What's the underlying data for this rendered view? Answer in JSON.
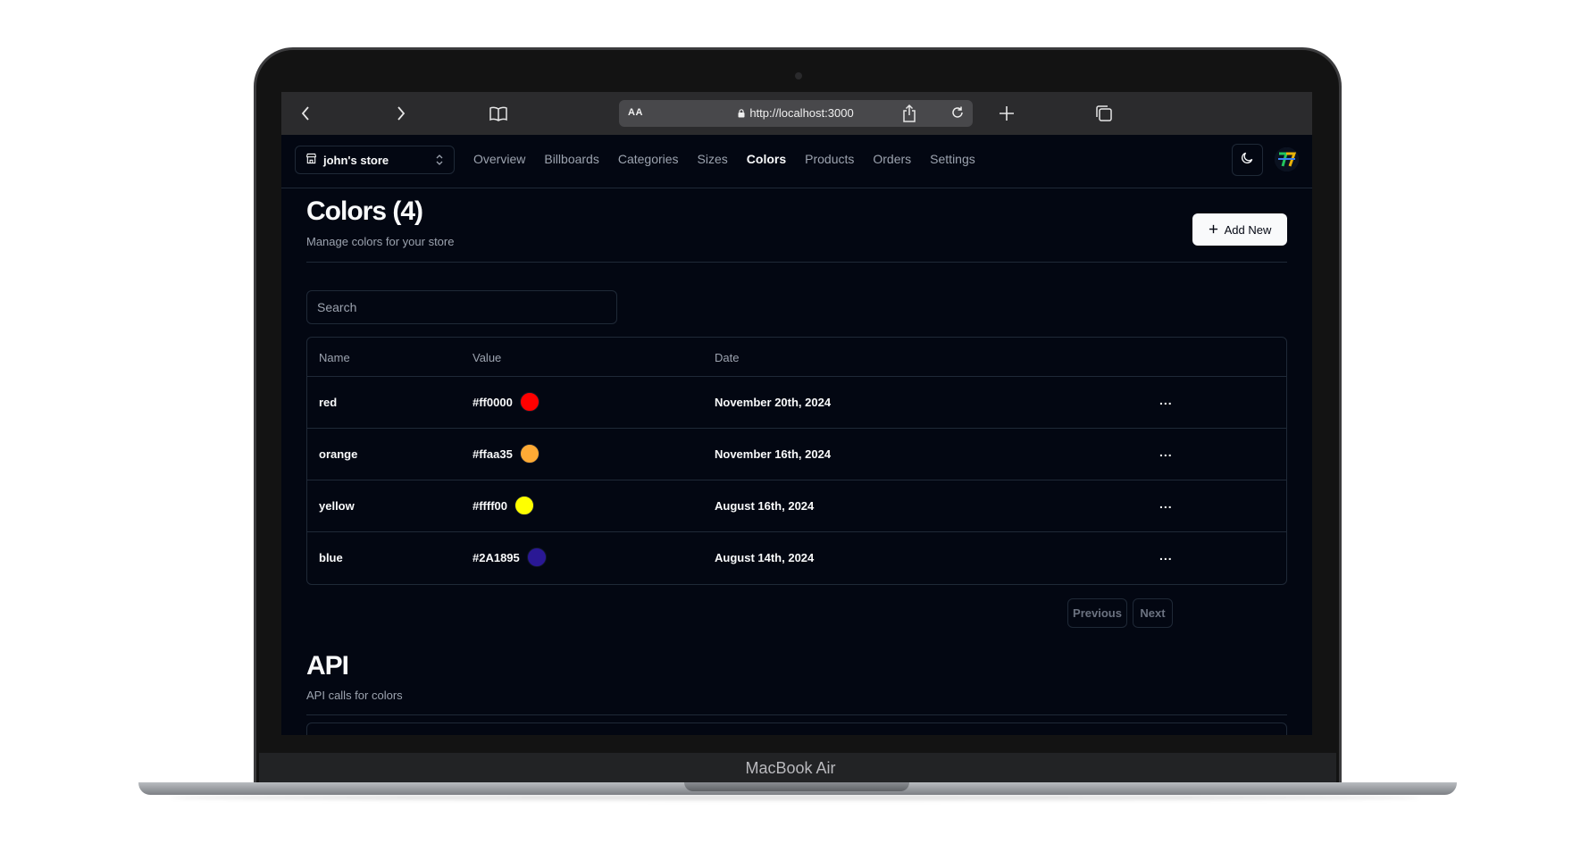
{
  "device": {
    "label": "MacBook Air"
  },
  "browser": {
    "text_size_label": "AA",
    "url": "http://localhost:3000"
  },
  "nav": {
    "store_name": "john's store",
    "links": [
      "Overview",
      "Billboards",
      "Categories",
      "Sizes",
      "Colors",
      "Products",
      "Orders",
      "Settings"
    ],
    "active": "Colors"
  },
  "header": {
    "title": "Colors (4)",
    "subtitle": "Manage colors for your store",
    "add_label": "Add New"
  },
  "search": {
    "placeholder": "Search"
  },
  "table": {
    "columns": [
      "Name",
      "Value",
      "Date"
    ],
    "rows": [
      {
        "name": "red",
        "value": "#ff0000",
        "swatch": "#ff0000",
        "date": "November 20th, 2024"
      },
      {
        "name": "orange",
        "value": "#ffaa35",
        "swatch": "#ffaa35",
        "date": "November 16th, 2024"
      },
      {
        "name": "yellow",
        "value": "#ffff00",
        "swatch": "#ffff00",
        "date": "August 16th, 2024"
      },
      {
        "name": "blue",
        "value": "#2A1895",
        "swatch": "#2A1895",
        "date": "August 14th, 2024"
      }
    ],
    "row_action": "..."
  },
  "pagination": {
    "previous": "Previous",
    "next": "Next"
  },
  "api": {
    "title": "API",
    "subtitle": "API calls for colors"
  }
}
